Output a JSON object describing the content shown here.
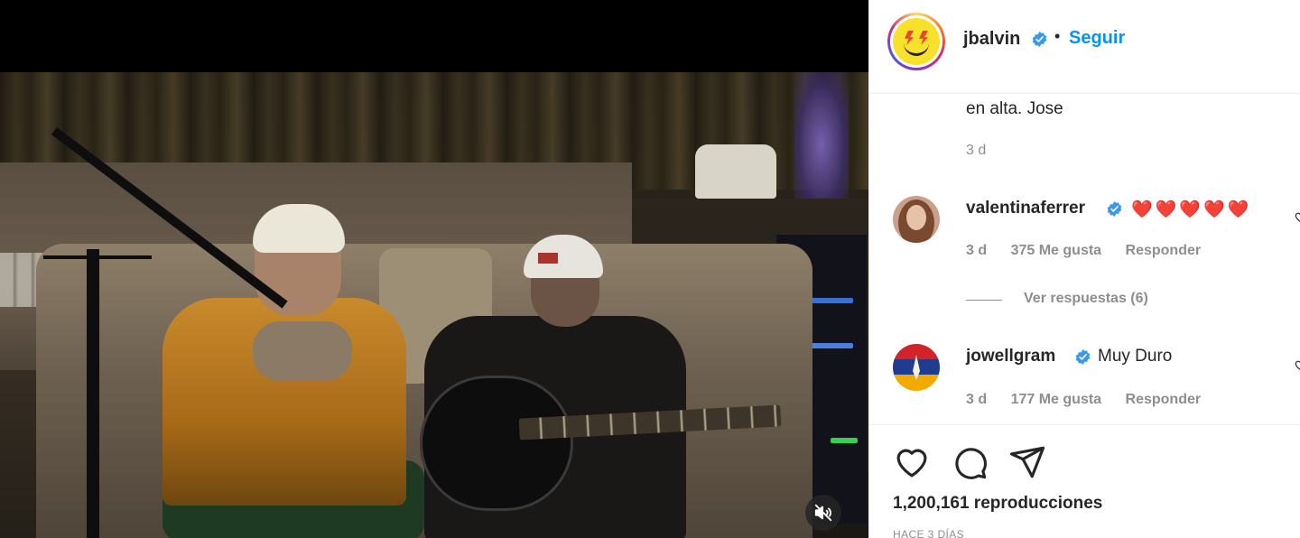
{
  "post": {
    "username": "jbalvin",
    "separator": "•",
    "follow_label": "Seguir",
    "verified": true
  },
  "caption": {
    "text": "en alta. Jose",
    "time": "3 d"
  },
  "comments": [
    {
      "username": "valentinaferrer",
      "text": "❤️❤️❤️❤️❤️",
      "time": "3 d",
      "likes": "375 Me gusta",
      "reply_label": "Responder",
      "view_replies": "Ver respuestas (6)",
      "verified": true
    },
    {
      "username": "jowellgram",
      "text": "Muy Duro",
      "time": "3 d",
      "likes": "177 Me gusta",
      "reply_label": "Responder",
      "verified": true
    }
  ],
  "stats": {
    "views": "1,200,161 reproducciones",
    "posted": "HACE 3 DÍAS"
  },
  "icons": {
    "like": "heart-icon",
    "comment": "comment-icon",
    "share": "send-icon",
    "mute": "speaker-muted-icon",
    "verified": "verified-badge-icon"
  },
  "colors": {
    "accent": "#0095f6",
    "verified": "#3897f0",
    "heart_emoji": "#ed1b24",
    "muted_text": "#8e8e8e"
  }
}
